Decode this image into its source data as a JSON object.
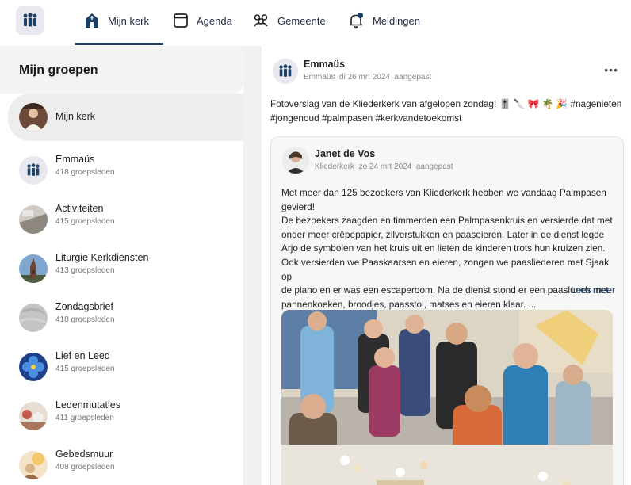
{
  "nav": {
    "items": [
      {
        "label": "Mijn kerk",
        "icon": "church-icon",
        "active": true
      },
      {
        "label": "Agenda",
        "icon": "calendar-icon"
      },
      {
        "label": "Gemeente",
        "icon": "people-icon"
      },
      {
        "label": "Meldingen",
        "icon": "bell-icon"
      }
    ],
    "active_color": "#1c3f66"
  },
  "sidebar": {
    "title": "Mijn groepen",
    "groups": [
      {
        "name": "Mijn kerk",
        "members": ""
      },
      {
        "name": "Emmaüs",
        "members": "418 groepsleden"
      },
      {
        "name": "Activiteiten",
        "members": "415 groepsleden"
      },
      {
        "name": "Liturgie Kerkdiensten",
        "members": "413 groepsleden"
      },
      {
        "name": "Zondagsbrief",
        "members": "418 groepsleden"
      },
      {
        "name": "Lief en Leed",
        "members": "415 groepsleden"
      },
      {
        "name": "Ledenmutaties",
        "members": "411 groepsleden"
      },
      {
        "name": "Gebedsmuur",
        "members": "408 groepsleden"
      }
    ]
  },
  "post": {
    "author": "Emmaüs",
    "meta": {
      "group": "Emmaüs",
      "date": "di 26 mrt 2024",
      "status": "aangepast"
    },
    "text_line1": "Fotoverslag van de Kliederkerk van afgelopen zondag! 🎚️ 🔪 🎀 🌴 🎉 #nagenieten",
    "text_line2": "#jongenoud #palmpasen #kerkvandetoekomst",
    "shared": {
      "author": "Janet de Vos",
      "meta": {
        "group": "Kliederkerk",
        "date": "zo 24 mrt 2024",
        "status": "aangepast"
      },
      "lines": [
        "Met meer dan 125 bezoekers van Kliederkerk hebben we vandaag Palmpasen",
        "gevierd!",
        "De bezoekers zaagden en timmerden een Palmpasenkruis en versierde dat met",
        "onder meer crêpepapier, zilverstukken en paaseieren. Later in de dienst legde",
        "Arjo de symbolen van het kruis uit en lieten de kinderen trots hun kruizen zien.",
        "Ook versierden we Paaskaarsen en eieren, zongen we paasliederen met Sjaak op",
        "de piano en er was een escaperoom. Na de dienst stond er een paaslunch met",
        "pannenkoeken, broodjes, paasstol, matses en eieren klaar. ..."
      ],
      "read_more": "Lees meer"
    }
  }
}
